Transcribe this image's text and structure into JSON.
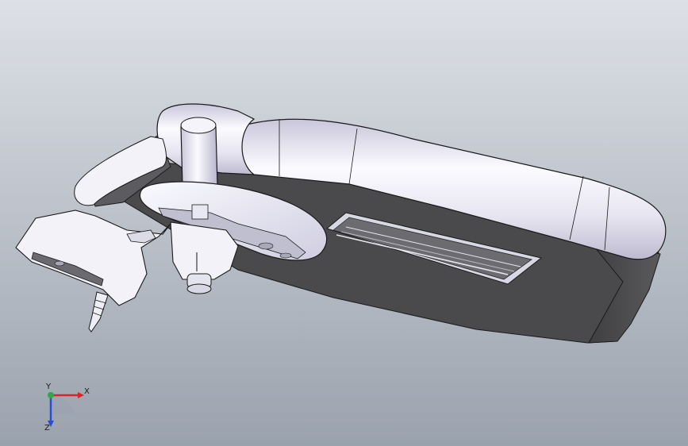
{
  "viewport": {
    "background_top": "#dde0e6",
    "background_bottom": "#9aa2ad"
  },
  "model": {
    "body_fill": "#4a4a4c",
    "tube_light": "#fbfbff",
    "tube_shade": "#c9c6da",
    "edge_color": "#1a1a1a",
    "visor_frame": "#d8d8e4",
    "clip_color": "#f2f2f8"
  },
  "triad": {
    "x_label": "X",
    "y_label": "Y",
    "z_label": "Z",
    "x_color": "#d8242a",
    "y_color": "#2ea84a",
    "z_color": "#2a4dd8"
  }
}
